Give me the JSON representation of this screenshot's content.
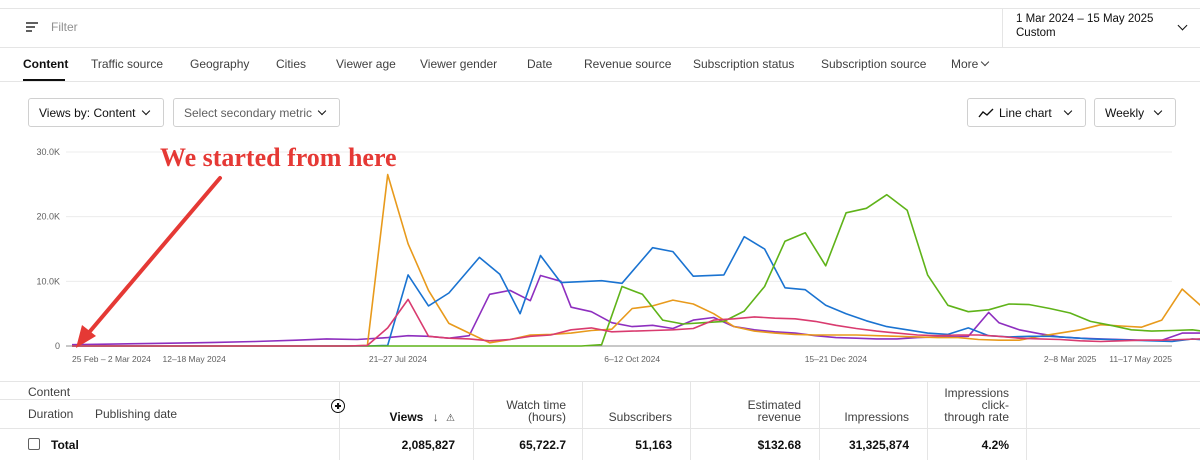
{
  "filter": {
    "placeholder": "Filter",
    "icon": "filter-icon"
  },
  "date_picker": {
    "range": "1 Mar 2024 – 15 May 2025",
    "mode": "Custom"
  },
  "tabs": [
    {
      "label": "Content",
      "active": true
    },
    {
      "label": "Traffic source"
    },
    {
      "label": "Geography"
    },
    {
      "label": "Cities"
    },
    {
      "label": "Viewer age"
    },
    {
      "label": "Viewer gender"
    },
    {
      "label": "Date"
    },
    {
      "label": "Revenue source"
    },
    {
      "label": "Subscription status"
    },
    {
      "label": "Subscription source"
    },
    {
      "label": "More"
    }
  ],
  "controls": {
    "views_by": "Views by: Content",
    "secondary_metric": "Select secondary metric",
    "chart_type": "Line chart",
    "interval": "Weekly"
  },
  "annotation": {
    "text": "We started from here",
    "color": "#e53935"
  },
  "chart_data": {
    "type": "line",
    "x": [
      "25 Feb – 2 Mar 2024",
      "",
      "",
      "",
      "",
      "",
      "",
      "",
      "",
      "",
      "",
      "",
      "12–18 May 2024",
      "",
      "",
      "",
      "",
      "",
      "",
      "",
      "",
      "",
      "",
      "",
      "",
      "",
      "",
      "",
      "",
      "",
      "",
      "",
      "21–27 Jul 2024",
      "",
      "",
      "",
      "",
      "",
      "",
      "",
      "",
      "",
      "",
      "",
      "",
      "",
      "",
      "",
      "",
      "",
      "",
      "",
      "",
      "",
      "",
      "6–12 Oct 2024",
      "",
      "",
      "",
      "",
      "",
      "",
      "",
      "",
      "",
      "",
      "",
      "",
      "",
      "",
      "",
      "",
      "",
      "",
      "",
      "15–21 Dec 2024",
      "",
      "",
      "",
      "",
      "",
      "",
      "",
      "",
      "",
      "",
      "",
      "",
      "",
      "",
      "",
      "",
      "",
      "",
      "",
      "",
      "",
      "",
      "2–8 Mar 2025",
      "",
      "",
      "",
      "",
      "",
      "",
      "",
      "",
      "",
      "11–17 May 2025"
    ],
    "x_ticks": [
      "25 Feb – 2 Mar 2024",
      "12–18 May 2024",
      "21–27 Jul 2024",
      "6–12 Oct 2024",
      "15–21 Dec 2024",
      "2–8 Mar 2025",
      "11–17 May 2025"
    ],
    "y_ticks": [
      "0",
      "10.0K",
      "20.0K",
      "30.0K"
    ],
    "ylim": [
      0,
      30000
    ],
    "grid": true,
    "colors": {
      "blue": "#1a73d1",
      "orange": "#e89a1c",
      "green": "#5fb319",
      "purple": "#8e2fbf",
      "pink": "#d93b6f"
    },
    "series": [
      {
        "color_key": "purple",
        "points": [
          [
            0,
            200
          ],
          [
            4,
            300
          ],
          [
            8,
            400
          ],
          [
            12,
            500
          ],
          [
            14,
            550
          ],
          [
            18,
            700
          ],
          [
            22,
            900
          ],
          [
            25,
            1100
          ],
          [
            28,
            1000
          ],
          [
            31,
            1300
          ],
          [
            33,
            1600
          ],
          [
            35,
            1500
          ],
          [
            37,
            1200
          ],
          [
            39,
            1600
          ],
          [
            41,
            8000
          ],
          [
            43,
            8600
          ],
          [
            45,
            7000
          ],
          [
            46,
            10900
          ],
          [
            48,
            10000
          ],
          [
            49,
            6000
          ],
          [
            51,
            5300
          ],
          [
            53,
            3600
          ],
          [
            55,
            3000
          ],
          [
            57,
            3200
          ],
          [
            59,
            2700
          ],
          [
            61,
            4000
          ],
          [
            63,
            4400
          ],
          [
            65,
            3000
          ],
          [
            67,
            2500
          ],
          [
            69,
            2200
          ],
          [
            71,
            2000
          ],
          [
            73,
            1600
          ],
          [
            75,
            1300
          ],
          [
            77,
            1200
          ],
          [
            79,
            1100
          ],
          [
            81,
            1100
          ],
          [
            83,
            1300
          ],
          [
            85,
            1400
          ],
          [
            88,
            1500
          ],
          [
            90,
            5200
          ],
          [
            91,
            3600
          ],
          [
            93,
            2500
          ],
          [
            95,
            1900
          ],
          [
            97,
            1400
          ],
          [
            99,
            1200
          ],
          [
            101,
            1100
          ],
          [
            103,
            1000
          ],
          [
            105,
            900
          ],
          [
            107,
            900
          ],
          [
            109,
            2000
          ],
          [
            111,
            2000
          ],
          [
            113,
            2200
          ],
          [
            115,
            1500
          ],
          [
            117,
            800
          ],
          [
            119,
            800
          ],
          [
            121,
            700
          ]
        ]
      },
      {
        "color_key": "orange",
        "points": [
          [
            0,
            0
          ],
          [
            27,
            0
          ],
          [
            29,
            100
          ],
          [
            31,
            26500
          ],
          [
            33,
            15800
          ],
          [
            35,
            8600
          ],
          [
            37,
            3500
          ],
          [
            39,
            2000
          ],
          [
            41,
            500
          ],
          [
            43,
            1000
          ],
          [
            45,
            1700
          ],
          [
            47,
            1800
          ],
          [
            49,
            2000
          ],
          [
            51,
            2400
          ],
          [
            53,
            2600
          ],
          [
            55,
            5800
          ],
          [
            57,
            6200
          ],
          [
            59,
            7100
          ],
          [
            61,
            6500
          ],
          [
            63,
            5000
          ],
          [
            65,
            3000
          ],
          [
            67,
            2300
          ],
          [
            69,
            2000
          ],
          [
            71,
            1800
          ],
          [
            73,
            1700
          ],
          [
            75,
            1700
          ],
          [
            77,
            1700
          ],
          [
            79,
            1600
          ],
          [
            81,
            1500
          ],
          [
            83,
            1400
          ],
          [
            85,
            1300
          ],
          [
            87,
            1300
          ],
          [
            89,
            1000
          ],
          [
            91,
            900
          ],
          [
            93,
            900
          ],
          [
            95,
            1500
          ],
          [
            97,
            2000
          ],
          [
            99,
            2500
          ],
          [
            101,
            3300
          ],
          [
            103,
            3100
          ],
          [
            105,
            2900
          ],
          [
            107,
            4000
          ],
          [
            109,
            8800
          ],
          [
            111,
            6000
          ],
          [
            113,
            7700
          ],
          [
            115,
            7300
          ],
          [
            117,
            4000
          ],
          [
            119,
            2800
          ]
        ]
      },
      {
        "color_key": "blue",
        "points": [
          [
            0,
            0
          ],
          [
            27,
            0
          ],
          [
            29,
            0
          ],
          [
            31,
            100
          ],
          [
            33,
            11000
          ],
          [
            35,
            6200
          ],
          [
            37,
            8200
          ],
          [
            40,
            13700
          ],
          [
            42,
            11100
          ],
          [
            44,
            5000
          ],
          [
            46,
            14000
          ],
          [
            48,
            9800
          ],
          [
            52,
            10100
          ],
          [
            54,
            9700
          ],
          [
            57,
            15200
          ],
          [
            59,
            14600
          ],
          [
            61,
            10800
          ],
          [
            64,
            11000
          ],
          [
            66,
            16900
          ],
          [
            68,
            15000
          ],
          [
            70,
            9000
          ],
          [
            72,
            8700
          ],
          [
            74,
            6300
          ],
          [
            76,
            5000
          ],
          [
            78,
            3900
          ],
          [
            80,
            3000
          ],
          [
            82,
            2500
          ],
          [
            84,
            2000
          ],
          [
            86,
            1800
          ],
          [
            88,
            2800
          ],
          [
            90,
            1600
          ],
          [
            92,
            1400
          ],
          [
            94,
            1500
          ],
          [
            96,
            1500
          ],
          [
            98,
            1300
          ],
          [
            100,
            1100
          ],
          [
            102,
            1000
          ],
          [
            104,
            900
          ],
          [
            106,
            800
          ],
          [
            108,
            700
          ],
          [
            110,
            1100
          ],
          [
            112,
            800
          ],
          [
            114,
            1000
          ],
          [
            116,
            900
          ],
          [
            118,
            800
          ]
        ]
      },
      {
        "color_key": "green",
        "points": [
          [
            0,
            0
          ],
          [
            50,
            0
          ],
          [
            52,
            200
          ],
          [
            54,
            9200
          ],
          [
            56,
            8000
          ],
          [
            58,
            4000
          ],
          [
            60,
            3400
          ],
          [
            62,
            3600
          ],
          [
            64,
            3800
          ],
          [
            66,
            5400
          ],
          [
            68,
            9200
          ],
          [
            70,
            16200
          ],
          [
            72,
            17500
          ],
          [
            74,
            12400
          ],
          [
            76,
            20600
          ],
          [
            78,
            21300
          ],
          [
            80,
            23400
          ],
          [
            82,
            21000
          ],
          [
            84,
            11000
          ],
          [
            86,
            6300
          ],
          [
            88,
            5300
          ],
          [
            90,
            5600
          ],
          [
            92,
            6500
          ],
          [
            94,
            6400
          ],
          [
            96,
            5800
          ],
          [
            98,
            5100
          ],
          [
            100,
            3800
          ],
          [
            102,
            3200
          ],
          [
            104,
            2500
          ],
          [
            106,
            2300
          ],
          [
            108,
            2400
          ],
          [
            110,
            2500
          ],
          [
            112,
            2100
          ],
          [
            114,
            1600
          ],
          [
            116,
            1500
          ],
          [
            118,
            2400
          ],
          [
            120,
            2200
          ],
          [
            122,
            2600
          ],
          [
            124,
            3200
          ],
          [
            126,
            4000
          ],
          [
            128,
            5400
          ]
        ]
      },
      {
        "color_key": "pink",
        "points": [
          [
            0,
            0
          ],
          [
            27,
            0
          ],
          [
            29,
            100
          ],
          [
            31,
            2800
          ],
          [
            33,
            7200
          ],
          [
            35,
            1500
          ],
          [
            37,
            1200
          ],
          [
            39,
            1100
          ],
          [
            41,
            800
          ],
          [
            43,
            1000
          ],
          [
            45,
            1500
          ],
          [
            47,
            1700
          ],
          [
            49,
            2500
          ],
          [
            51,
            2800
          ],
          [
            53,
            2200
          ],
          [
            55,
            2300
          ],
          [
            57,
            2400
          ],
          [
            59,
            2500
          ],
          [
            61,
            2700
          ],
          [
            63,
            4000
          ],
          [
            65,
            4200
          ],
          [
            67,
            4500
          ],
          [
            69,
            4300
          ],
          [
            71,
            4200
          ],
          [
            73,
            3800
          ],
          [
            75,
            3200
          ],
          [
            77,
            2700
          ],
          [
            79,
            2300
          ],
          [
            81,
            2000
          ],
          [
            83,
            1700
          ],
          [
            85,
            1600
          ],
          [
            87,
            1700
          ],
          [
            89,
            1700
          ],
          [
            91,
            1500
          ],
          [
            93,
            1200
          ],
          [
            95,
            1100
          ],
          [
            97,
            1000
          ],
          [
            99,
            800
          ],
          [
            101,
            700
          ],
          [
            103,
            800
          ],
          [
            105,
            900
          ],
          [
            107,
            900
          ],
          [
            109,
            1000
          ],
          [
            111,
            1100
          ],
          [
            113,
            1300
          ],
          [
            115,
            2800
          ],
          [
            117,
            3300
          ],
          [
            119,
            3500
          ],
          [
            121,
            1800
          ]
        ]
      }
    ]
  },
  "table": {
    "group_header": "Content",
    "col_duration": "Duration",
    "col_publishing": "Publishing date",
    "columns": [
      {
        "line1": "",
        "line2": "Views"
      },
      {
        "line1": "Watch time",
        "line2": "(hours)"
      },
      {
        "line1": "",
        "line2": "Subscribers"
      },
      {
        "line1": "Estimated",
        "line2": "revenue"
      },
      {
        "line1": "",
        "line2": "Impressions"
      },
      {
        "line1": "Impressions",
        "line2": "click-",
        "line3": "through rate"
      }
    ],
    "total_label": "Total",
    "totals": [
      "2,085,827",
      "65,722.7",
      "51,163",
      "$132.68",
      "31,325,874",
      "4.2%"
    ]
  }
}
